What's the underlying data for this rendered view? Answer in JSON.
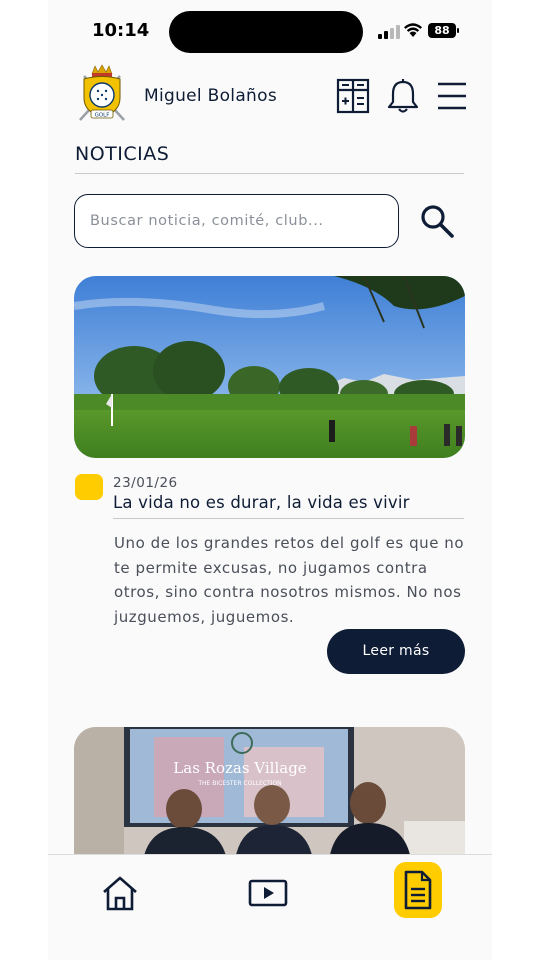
{
  "status": {
    "time": "10:14",
    "battery": "88"
  },
  "header": {
    "user_name": "Miguel Bolaños",
    "logo_text": "GOLF",
    "icons": [
      "calculator-icon",
      "bell-icon",
      "menu-icon"
    ]
  },
  "section": {
    "title": "NOTICIAS"
  },
  "search": {
    "placeholder": "Buscar noticia, comité, club..."
  },
  "news": [
    {
      "date": "23/01/26",
      "title": "La vida no es durar, la vida es vivir",
      "excerpt": "Uno de los grandes retos del golf es que no te permite excusas, no jugamos contra otros, sino contra nosotros mismos. No nos juzguemos, juguemos.",
      "button": "Leer más",
      "badge_color": "#ffcc00"
    },
    {
      "image_text": "Las Rozas Village",
      "image_subtext": "THE BICESTER COLLECTION"
    }
  ],
  "bottom_nav": {
    "items": [
      "home-icon",
      "video-icon",
      "document-icon"
    ],
    "active": "document-icon"
  },
  "colors": {
    "primary": "#0e1c36",
    "accent": "#ffcc00"
  }
}
